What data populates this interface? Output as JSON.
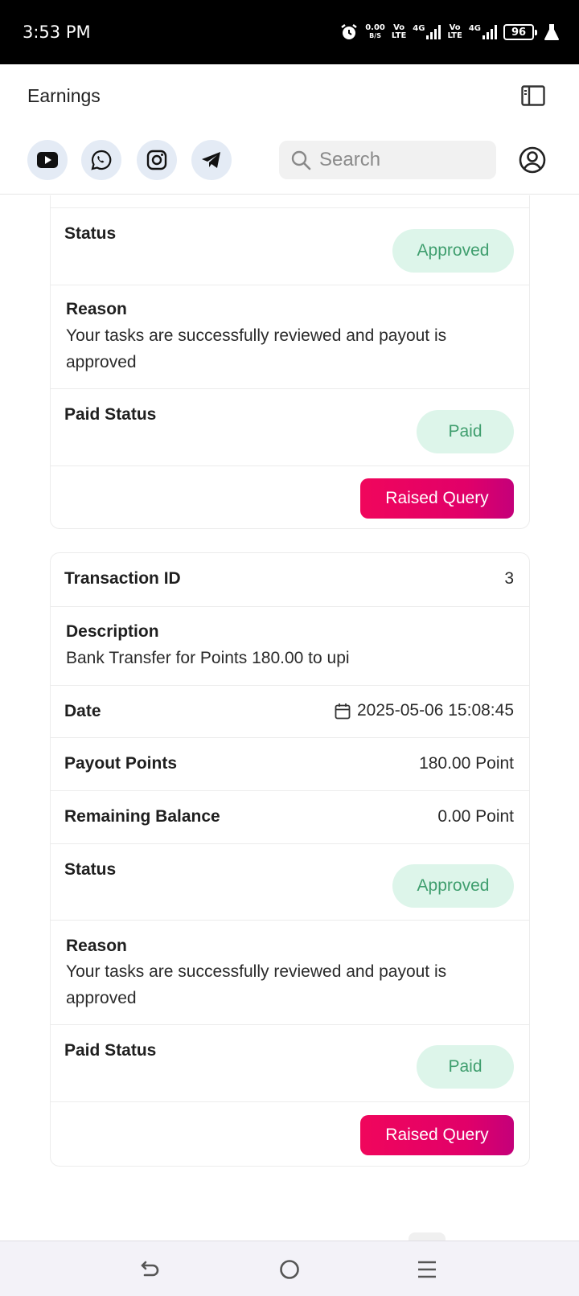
{
  "status_bar": {
    "time": "3:53 PM",
    "net_speed_value": "0.00",
    "net_speed_unit": "B/S",
    "volte1": [
      "Vo",
      "LTE"
    ],
    "sim1": "4G",
    "volte2": [
      "Vo",
      "LTE"
    ],
    "sim2": "4G",
    "battery": "96",
    "icons": [
      "alarm-icon",
      "signal-icon",
      "battery-icon",
      "flask-icon"
    ]
  },
  "header": {
    "title": "Earnings",
    "social_icons": [
      "youtube-icon",
      "whatsapp-icon",
      "instagram-icon",
      "telegram-icon"
    ],
    "search_placeholder": "Search"
  },
  "card_top": {
    "status_label": "Status",
    "status_value": "Approved",
    "reason_label": "Reason",
    "reason_text": "Your tasks are successfully reviewed and payout is approved",
    "paid_status_label": "Paid Status",
    "paid_status_value": "Paid",
    "query_button": "Raised Query"
  },
  "card_main": {
    "transaction_id_label": "Transaction ID",
    "transaction_id": "3",
    "description_label": "Description",
    "description": "Bank Transfer for Points 180.00 to upi",
    "date_label": "Date",
    "date": "2025-05-06 15:08:45",
    "payout_label": "Payout Points",
    "payout": "180.00 Point",
    "remaining_label": "Remaining Balance",
    "remaining": "0.00 Point",
    "status_label": "Status",
    "status_value": "Approved",
    "reason_label": "Reason",
    "reason_text": "Your tasks are successfully reviewed and payout is approved",
    "paid_status_label": "Paid Status",
    "paid_status_value": "Paid",
    "query_button": "Raised Query"
  },
  "colors": {
    "accent": "#e6006a",
    "badge_bg": "#ddf5ea",
    "badge_text": "#3f9e6e"
  },
  "nav": [
    "back-icon",
    "home-icon",
    "menu-icon"
  ]
}
